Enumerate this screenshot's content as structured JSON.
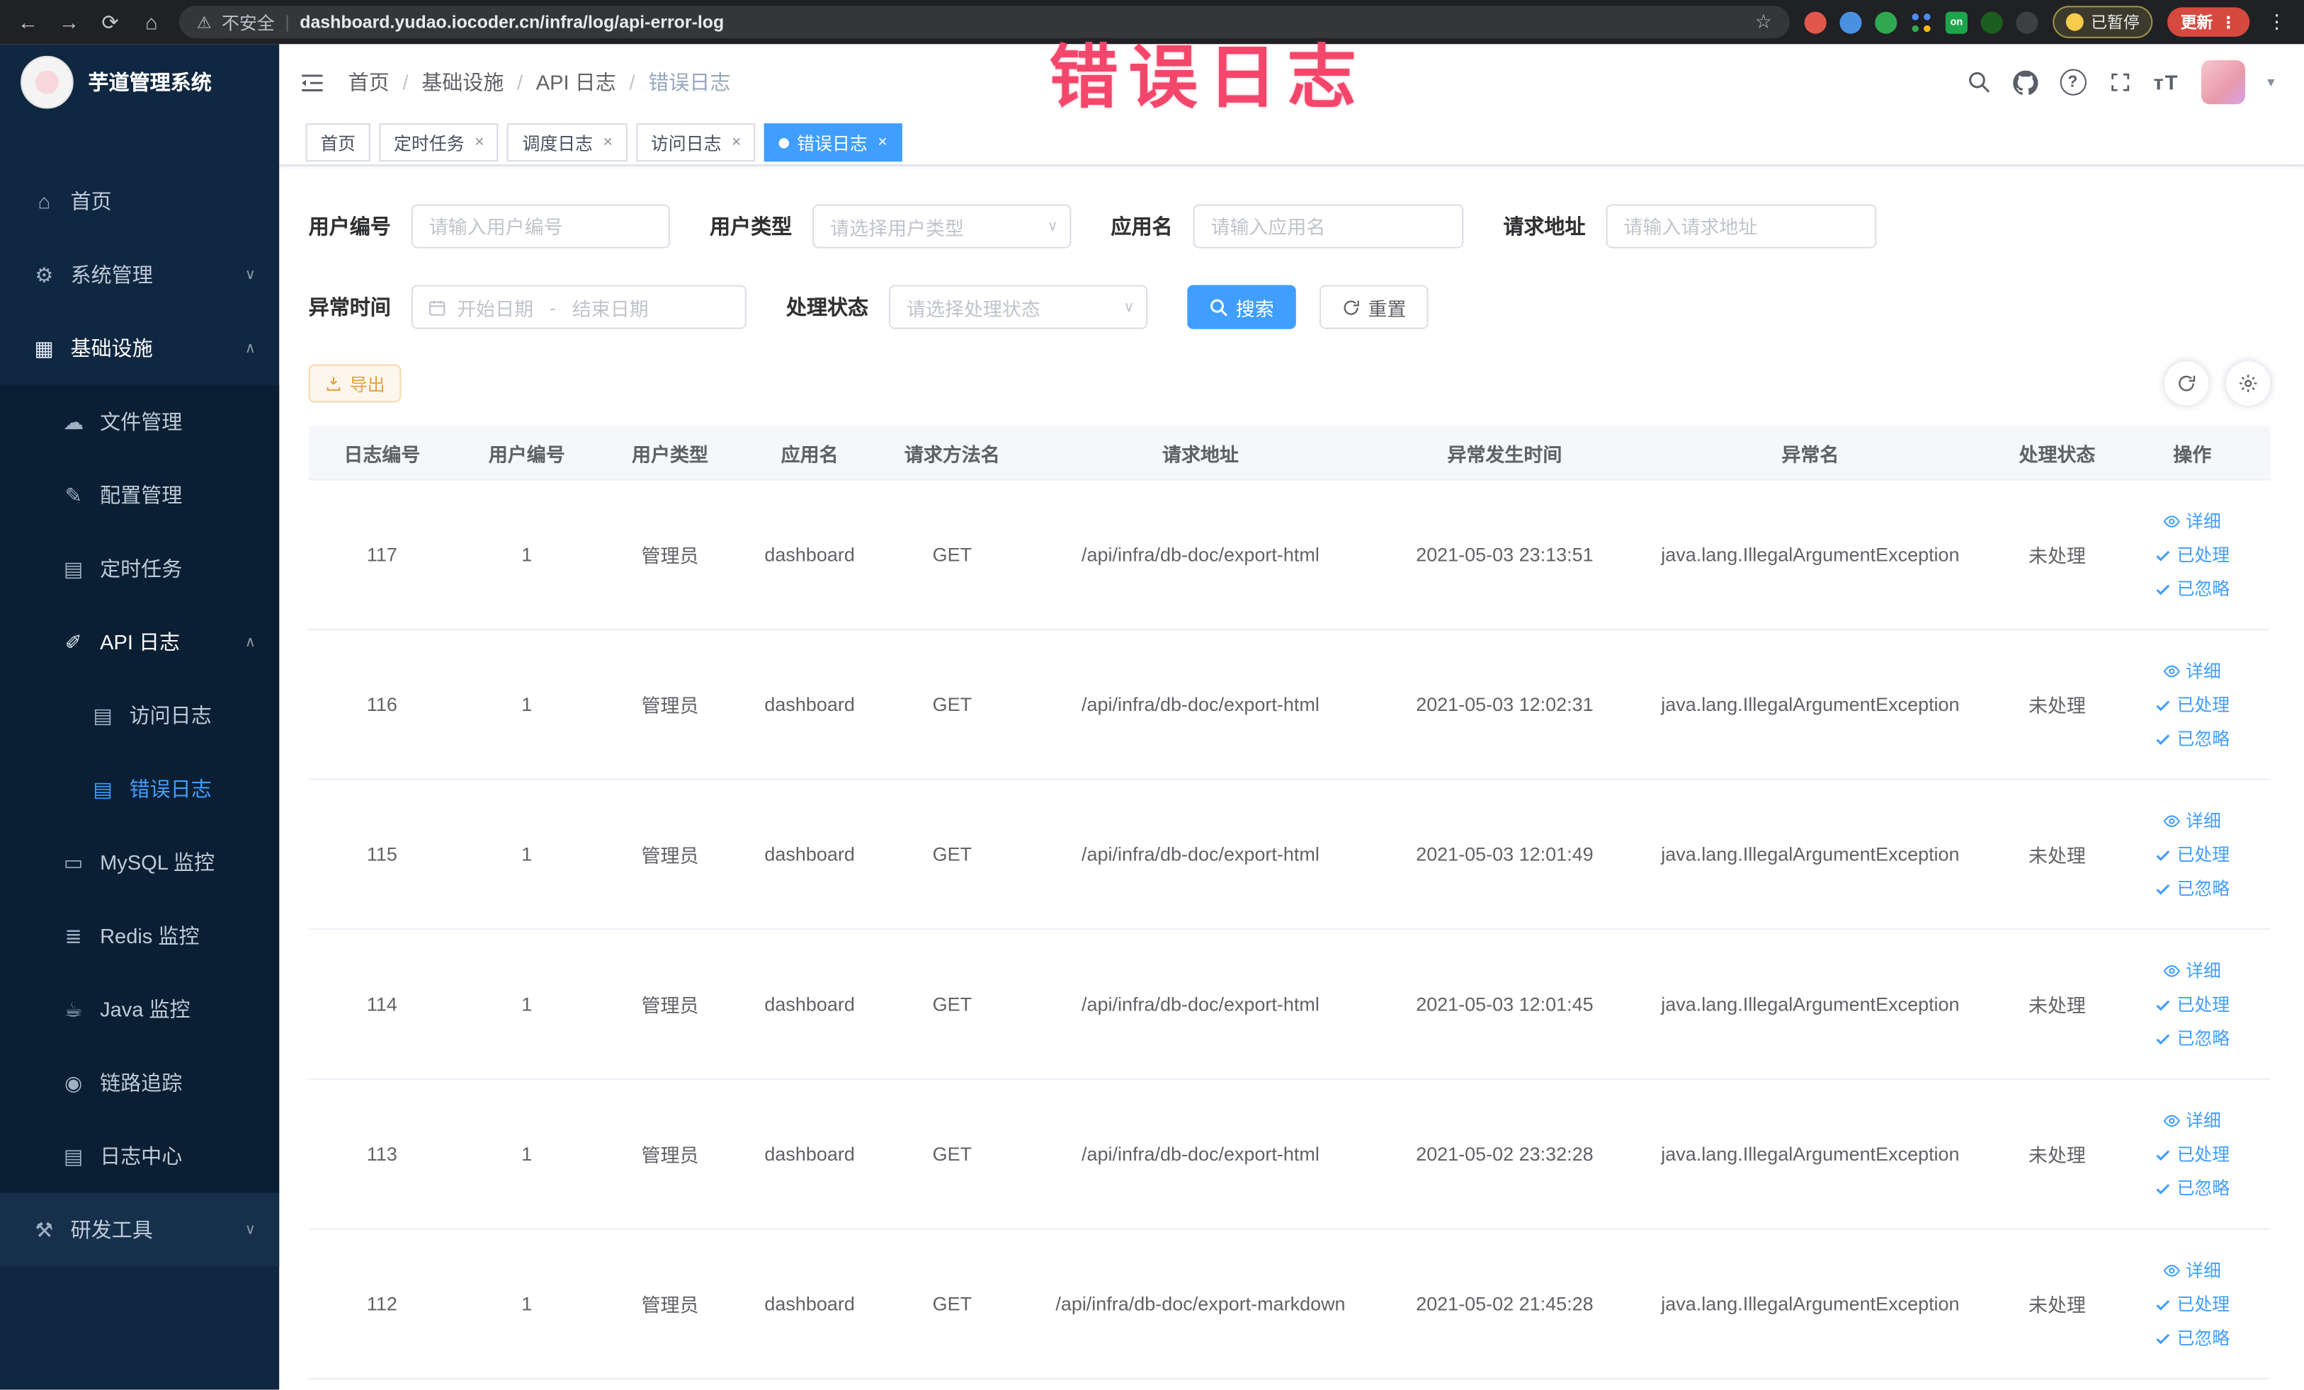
{
  "colors": {
    "primary": "#409eff",
    "warning": "#e6a23c",
    "annotation": "#f4466b",
    "sidebar_bg": "#0f2741",
    "submenu_bg": "#0a1f33",
    "chrome_bg": "#202124",
    "active_tab": "#409eff"
  },
  "glyphs": {
    "back": "←",
    "forward": "→",
    "reload": "⟳",
    "home": "⌂",
    "star": "☆",
    "warning": "⚠",
    "kebab": "⋮",
    "pipe": "|",
    "slash": "/",
    "chevron_down": "∨",
    "chevron_up": "∧",
    "select_caret": "∨",
    "user_caret": "▾",
    "close": "×",
    "question": "?"
  },
  "browser": {
    "security_label": "不安全",
    "url": "dashboard.yudao.iocoder.cn/infra/log/api-error-log",
    "paused_badge": "已暂停",
    "update_button": "更新",
    "extension_on_badge": "on"
  },
  "annotation": {
    "text": "错误日志"
  },
  "sidebar": {
    "logo_title": "芋道管理系统",
    "items": [
      {
        "label": "首页",
        "glyph": "⌂"
      },
      {
        "label": "系统管理",
        "glyph": "⚙"
      },
      {
        "label": "基础设施",
        "glyph": "▦"
      },
      {
        "label": "文件管理",
        "glyph": "☁"
      },
      {
        "label": "配置管理",
        "glyph": "✎"
      },
      {
        "label": "定时任务",
        "glyph": "▤"
      },
      {
        "label": "API 日志",
        "glyph": "✐"
      },
      {
        "label": "访问日志",
        "glyph": "▤"
      },
      {
        "label": "错误日志",
        "glyph": "▤"
      },
      {
        "label": "MySQL 监控",
        "glyph": "▭"
      },
      {
        "label": "Redis 监控",
        "glyph": "≣"
      },
      {
        "label": "Java 监控",
        "glyph": "☕"
      },
      {
        "label": "链路追踪",
        "glyph": "◉"
      },
      {
        "label": "日志中心",
        "glyph": "▤"
      },
      {
        "label": "研发工具",
        "glyph": "⚒"
      }
    ]
  },
  "header": {
    "breadcrumb": [
      "首页",
      "基础设施",
      "API 日志",
      "错误日志"
    ],
    "font_size_icon_text": "тT"
  },
  "tabs": [
    {
      "label": "首页"
    },
    {
      "label": "定时任务"
    },
    {
      "label": "调度日志"
    },
    {
      "label": "访问日志"
    },
    {
      "label": "错误日志"
    }
  ],
  "filters": {
    "user_id_label": "用户编号",
    "user_id_placeholder": "请输入用户编号",
    "user_type_label": "用户类型",
    "user_type_placeholder": "请选择用户类型",
    "app_name_label": "应用名",
    "app_name_placeholder": "请输入应用名",
    "request_url_label": "请求地址",
    "request_url_placeholder": "请输入请求地址",
    "time_label": "异常时间",
    "time_start_placeholder": "开始日期",
    "time_separator": "-",
    "time_end_placeholder": "结束日期",
    "status_label": "处理状态",
    "status_placeholder": "请选择处理状态",
    "search_label": "搜索",
    "reset_label": "重置"
  },
  "toolbar": {
    "export_label": "导出"
  },
  "table": {
    "columns": [
      "日志编号",
      "用户编号",
      "用户类型",
      "应用名",
      "请求方法名",
      "请求地址",
      "异常发生时间",
      "异常名",
      "处理状态",
      "操作"
    ],
    "actions": {
      "detail": "详细",
      "processed": "已处理",
      "ignored": "已忽略"
    },
    "rows": [
      {
        "id": "117",
        "user_id": "1",
        "user_type": "管理员",
        "app": "dashboard",
        "method": "GET",
        "url": "/api/infra/db-doc/export-html",
        "time": "2021-05-03 23:13:51",
        "exception": "java.lang.IllegalArgumentException",
        "status": "未处理"
      },
      {
        "id": "116",
        "user_id": "1",
        "user_type": "管理员",
        "app": "dashboard",
        "method": "GET",
        "url": "/api/infra/db-doc/export-html",
        "time": "2021-05-03 12:02:31",
        "exception": "java.lang.IllegalArgumentException",
        "status": "未处理"
      },
      {
        "id": "115",
        "user_id": "1",
        "user_type": "管理员",
        "app": "dashboard",
        "method": "GET",
        "url": "/api/infra/db-doc/export-html",
        "time": "2021-05-03 12:01:49",
        "exception": "java.lang.IllegalArgumentException",
        "status": "未处理"
      },
      {
        "id": "114",
        "user_id": "1",
        "user_type": "管理员",
        "app": "dashboard",
        "method": "GET",
        "url": "/api/infra/db-doc/export-html",
        "time": "2021-05-03 12:01:45",
        "exception": "java.lang.IllegalArgumentException",
        "status": "未处理"
      },
      {
        "id": "113",
        "user_id": "1",
        "user_type": "管理员",
        "app": "dashboard",
        "method": "GET",
        "url": "/api/infra/db-doc/export-html",
        "time": "2021-05-02 23:32:28",
        "exception": "java.lang.IllegalArgumentException",
        "status": "未处理"
      },
      {
        "id": "112",
        "user_id": "1",
        "user_type": "管理员",
        "app": "dashboard",
        "method": "GET",
        "url": "/api/infra/db-doc/export-markdown",
        "time": "2021-05-02 21:45:28",
        "exception": "java.lang.IllegalArgumentException",
        "status": "未处理"
      }
    ]
  }
}
